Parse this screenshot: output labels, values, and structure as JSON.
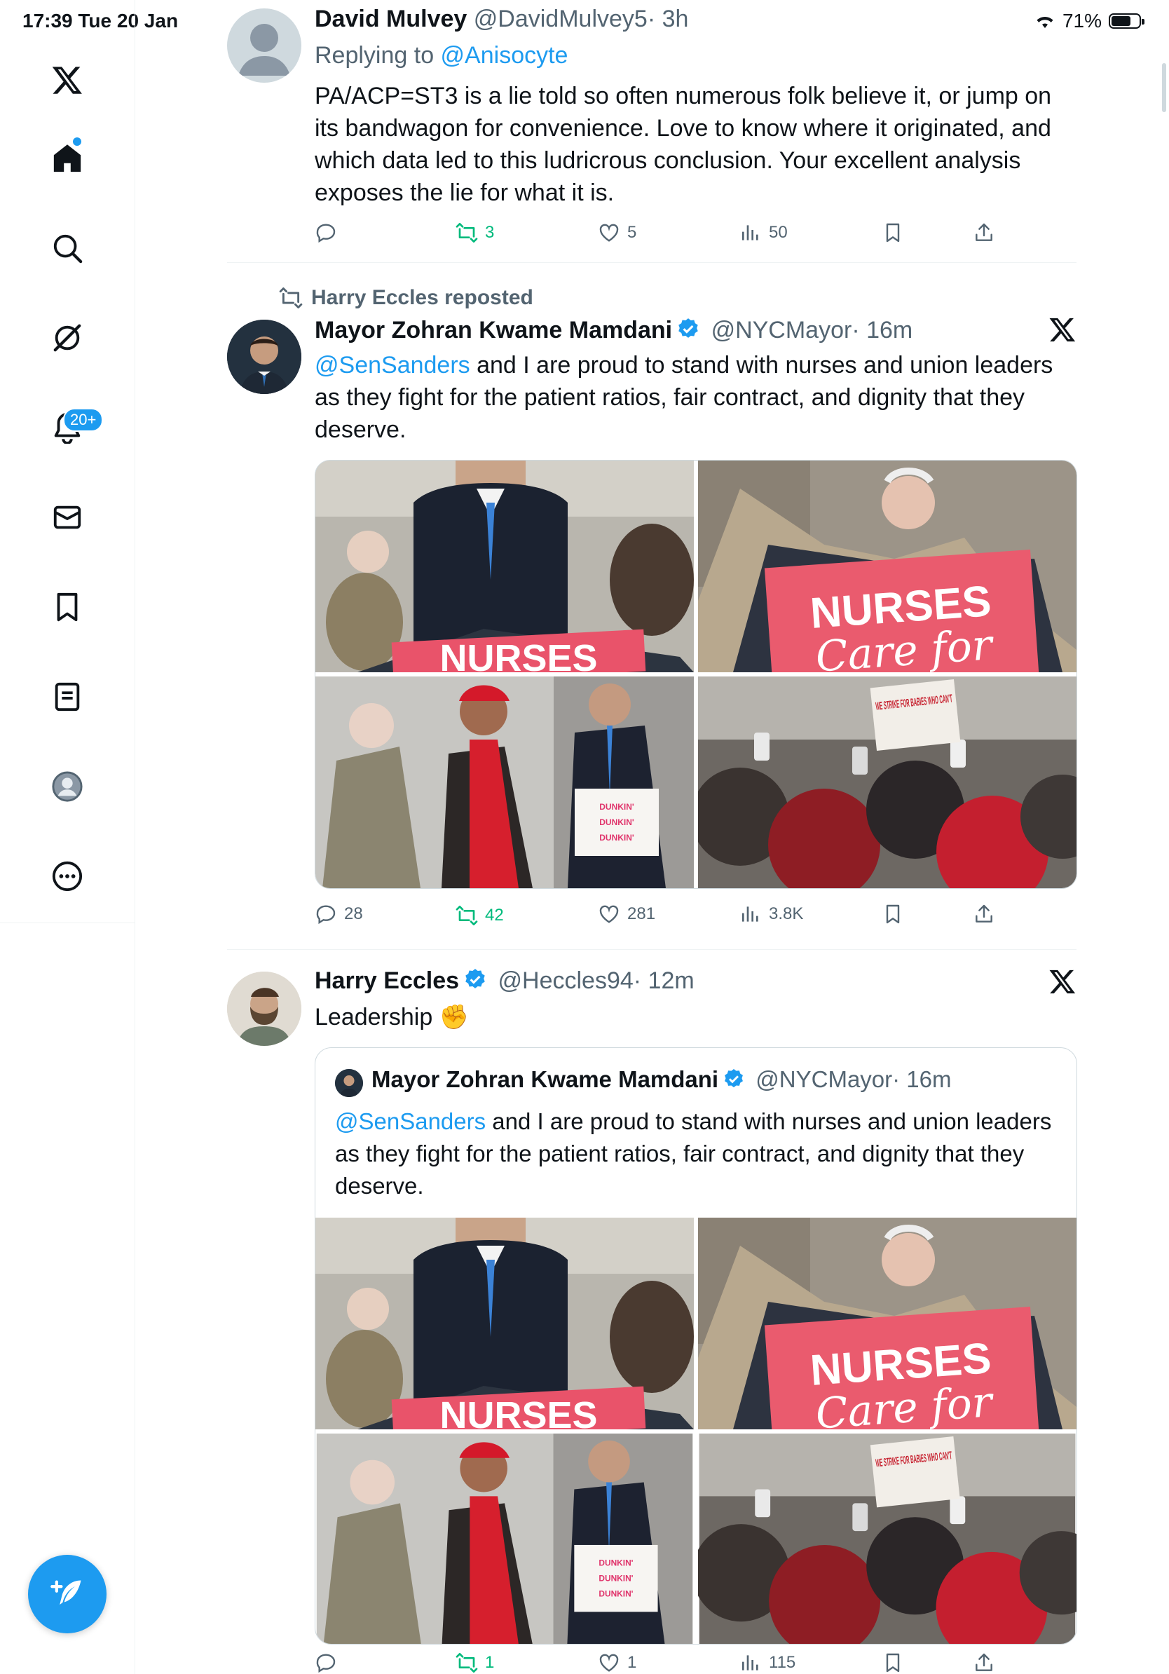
{
  "status_bar": {
    "time": "17:39  Tue 20 Jan",
    "battery": "71%",
    "battery_level": 0.71
  },
  "sidebar": {
    "notifications_badge": "20+"
  },
  "tweet1": {
    "name": "David Mulvey",
    "handle": "@DavidMulvey5",
    "time": "· 3h",
    "replying_prefix": "Replying to ",
    "replying_to": "@Anisocyte",
    "text": "PA/ACP=ST3 is a lie told so often numerous folk believe it, or jump on its bandwagon for convenience. Love to know where it originated, and which data led to this ludricrous conclusion. Your excellent analysis exposes the lie for what it is.",
    "replies": "",
    "reposts": "3",
    "likes": "5",
    "views": "50"
  },
  "tweet2": {
    "reposted_by": "Harry Eccles reposted",
    "name": "Mayor Zohran Kwame Mamdani",
    "handle": "@NYCMayor",
    "time": "· 16m",
    "mention": "@SenSanders",
    "text": " and I are proud to stand with nurses and union leaders as they fight for the patient ratios, fair contract, and dignity that they deserve.",
    "replies": "28",
    "reposts": "42",
    "likes": "281",
    "views": "3.8K",
    "sign_nurses": "NURSES",
    "sign_care": "Care for",
    "box_label": "DUNKIN'",
    "sign_strike": "WE STRIKE FOR BABIES WHO CAN'T"
  },
  "tweet3": {
    "name": "Harry Eccles",
    "handle": "@Heccles94",
    "time": "· 12m",
    "text": "Leadership ✊",
    "replies": "",
    "reposts": "1",
    "likes": "1",
    "views": "115",
    "quote": {
      "name": "Mayor Zohran Kwame Mamdani",
      "handle": "@NYCMayor",
      "time": "· 16m",
      "mention": "@SenSanders",
      "text": " and I are proud to stand with nurses and union leaders as they fight for the patient ratios, fair contract, and dignity that they deserve."
    }
  },
  "colors": {
    "accent": "#1d9bf0",
    "repost_green": "#00ba7c",
    "muted": "#536471"
  }
}
